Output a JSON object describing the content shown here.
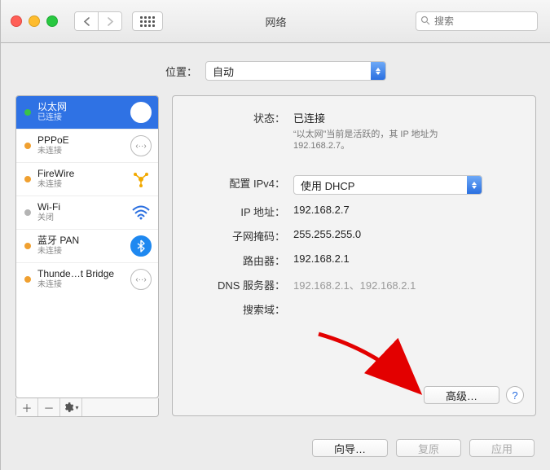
{
  "window": {
    "title": "网络"
  },
  "search": {
    "placeholder": "搜索"
  },
  "location": {
    "label": "位置：",
    "value": "自动"
  },
  "sidebar": {
    "items": [
      {
        "name": "以太网",
        "sub": "已连接",
        "status": "green",
        "icon": "ethernet"
      },
      {
        "name": "PPPoE",
        "sub": "未连接",
        "status": "orange",
        "icon": "ethernet"
      },
      {
        "name": "FireWire",
        "sub": "未连接",
        "status": "orange",
        "icon": "firewire"
      },
      {
        "name": "Wi-Fi",
        "sub": "关闭",
        "status": "gray",
        "icon": "wifi"
      },
      {
        "name": "蓝牙 PAN",
        "sub": "未连接",
        "status": "orange",
        "icon": "bluetooth"
      },
      {
        "name": "Thunde…t Bridge",
        "sub": "未连接",
        "status": "orange",
        "icon": "ethernet"
      }
    ]
  },
  "details": {
    "status_label": "状态：",
    "status_value": "已连接",
    "status_desc": "“以太网”当前是活跃的，其 IP 地址为 192.168.2.7。",
    "configure_label": "配置 IPv4：",
    "configure_value": "使用 DHCP",
    "ip_label": "IP 地址：",
    "ip_value": "192.168.2.7",
    "mask_label": "子网掩码：",
    "mask_value": "255.255.255.0",
    "router_label": "路由器：",
    "router_value": "192.168.2.1",
    "dns_label": "DNS 服务器：",
    "dns_value": "192.168.2.1、192.168.2.1",
    "searchdomain_label": "搜索域：",
    "advanced_button": "高级…",
    "help": "?"
  },
  "buttons": {
    "assist": "向导…",
    "revert": "复原",
    "apply": "应用"
  }
}
